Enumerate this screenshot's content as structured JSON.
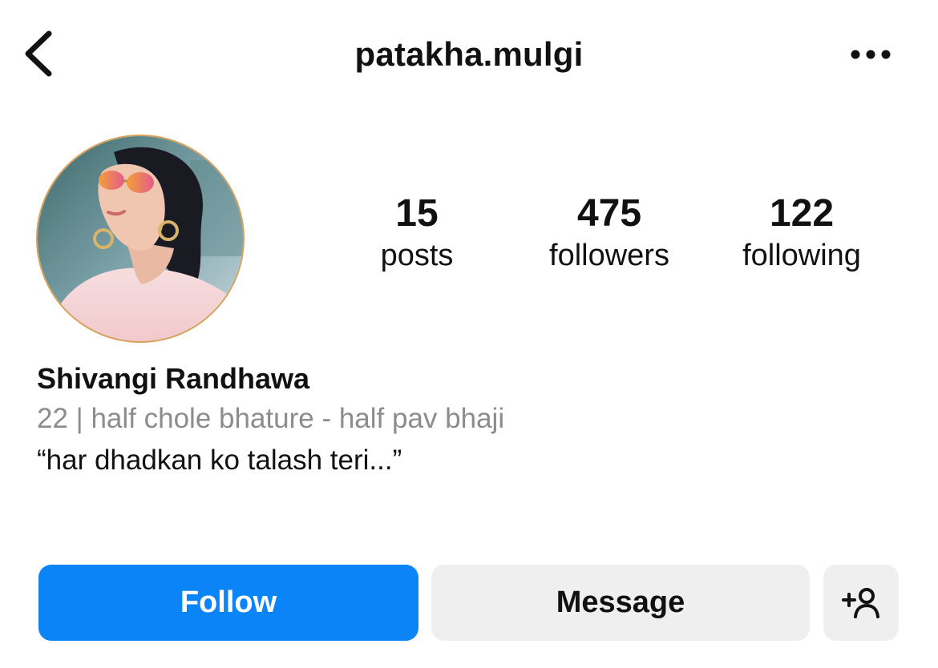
{
  "header": {
    "username": "patakha.mulgi",
    "back_icon": "chevron-left-icon",
    "more_icon": "more-horizontal-icon"
  },
  "profile": {
    "avatar_icon": "profile-photo",
    "display_name": "Shivangi Randhawa",
    "bio_line1": "22 | half chole bhature - half pav bhaji",
    "bio_line2": "“har dhadkan ko talash teri...”"
  },
  "stats": {
    "posts": {
      "count": "15",
      "label": "posts"
    },
    "followers": {
      "count": "475",
      "label": "followers"
    },
    "following": {
      "count": "122",
      "label": "following"
    }
  },
  "actions": {
    "follow_label": "Follow",
    "message_label": "Message",
    "add_user_icon": "add-user-icon"
  },
  "colors": {
    "accent": "#0b84f8",
    "secondary_button": "#efefef",
    "muted_text": "#8c8c8c"
  }
}
